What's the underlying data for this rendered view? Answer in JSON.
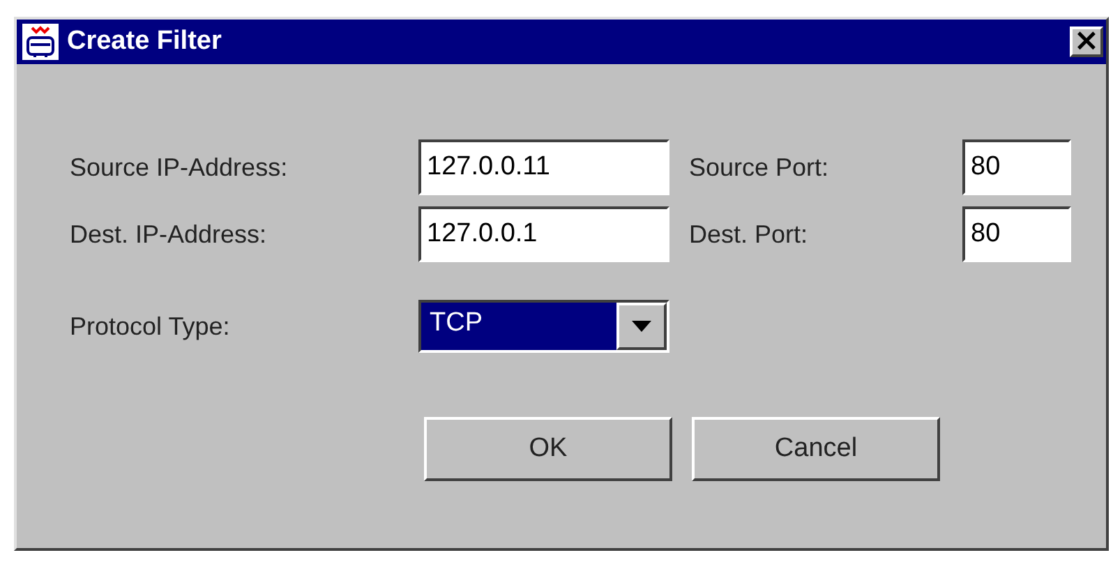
{
  "window": {
    "title": "Create Filter",
    "close_glyph": "×"
  },
  "fields": [
    {
      "label": "Source IP-Address:",
      "value": "127.0.0.11",
      "port_label": "Source Port:",
      "port_value": "80"
    },
    {
      "label": "Dest. IP-Address:",
      "value": "127.0.0.1",
      "port_label": "Dest. Port:",
      "port_value": "80"
    }
  ],
  "protocol": {
    "label": "Protocol Type:",
    "value": "TCP"
  },
  "buttons": [
    "OK",
    "Cancel"
  ]
}
